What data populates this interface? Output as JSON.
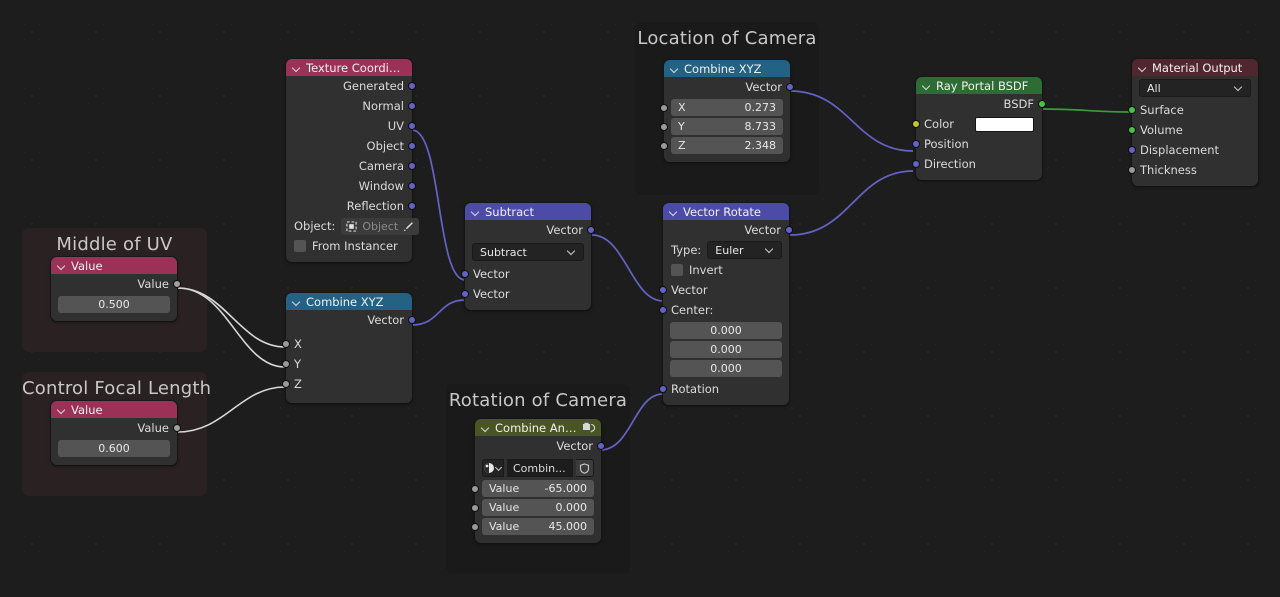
{
  "editor": {
    "name": "blender-shader-node-editor",
    "background": "#1d1d1d"
  },
  "colors": {
    "header_texture": "#9c3157",
    "header_value": "#9c3157",
    "header_output": "#50272f",
    "header_vector": "#4c4ca8",
    "header_converter": "#246283",
    "header_shader": "#2f6b34",
    "header_group": "#495622",
    "socket_vector": "#6363c7",
    "socket_shader": "#4ac24a",
    "socket_color": "#c7c729",
    "socket_float": "#9a9a9a",
    "link_gray": "#d8d8d8",
    "link_vector": "#6363c7",
    "link_shader": "#3c9c3c"
  },
  "frames": [
    {
      "label": "Middle of UV"
    },
    {
      "label": "Control Focal Length"
    },
    {
      "label": "Location of Camera"
    },
    {
      "label": "Rotation of Camera"
    }
  ],
  "nodes": {
    "texture_coordinate": {
      "title": "Texture Coordinate",
      "outputs": [
        "Generated",
        "Normal",
        "UV",
        "Object",
        "Camera",
        "Window",
        "Reflection"
      ],
      "object_label": "Object:",
      "object_value": "Object",
      "from_instancer_label": "From Instancer"
    },
    "value_uv": {
      "title": "Value",
      "output_label": "Value",
      "value": "0.500"
    },
    "value_focal": {
      "title": "Value",
      "output_label": "Value",
      "value": "0.600"
    },
    "combine_xyz_left": {
      "title": "Combine XYZ",
      "output_label": "Vector",
      "inputs": [
        "X",
        "Y",
        "Z"
      ]
    },
    "combine_xyz_location": {
      "title": "Combine XYZ",
      "output_label": "Vector",
      "fields": [
        {
          "name": "X",
          "value": "0.273"
        },
        {
          "name": "Y",
          "value": "8.733"
        },
        {
          "name": "Z",
          "value": "2.348"
        }
      ]
    },
    "subtract": {
      "title": "Subtract",
      "output_label": "Vector",
      "operation": "Subtract",
      "inputs": [
        "Vector",
        "Vector"
      ]
    },
    "vector_rotate": {
      "title": "Vector Rotate",
      "output_label": "Vector",
      "type_label": "Type:",
      "type_value": "Euler",
      "invert_label": "Invert",
      "vector_input": "Vector",
      "center_label": "Center:",
      "center_values": [
        "0.000",
        "0.000",
        "0.000"
      ],
      "rotation_input": "Rotation"
    },
    "combine_angles": {
      "title": "Combine Angles",
      "output_label": "Vector",
      "datablock_name": "Combin...",
      "fields": [
        {
          "name": "Value",
          "value": "-65.000"
        },
        {
          "name": "Value",
          "value": "0.000"
        },
        {
          "name": "Value",
          "value": "45.000"
        }
      ]
    },
    "ray_portal_bsdf": {
      "title": "Ray Portal BSDF",
      "output_label": "BSDF",
      "color_label": "Color",
      "color_value": "#ffffff",
      "position_label": "Position",
      "direction_label": "Direction"
    },
    "material_output": {
      "title": "Material Output",
      "target": "All",
      "inputs": [
        "Surface",
        "Volume",
        "Displacement",
        "Thickness"
      ]
    }
  },
  "links": [
    {
      "from": "texture_coordinate.UV",
      "to": "subtract.Vector1"
    },
    {
      "from": "combine_xyz_left.Vector",
      "to": "subtract.Vector2"
    },
    {
      "from": "value_uv.Value",
      "to": "combine_xyz_left.X"
    },
    {
      "from": "value_uv.Value",
      "to": "combine_xyz_left.Y"
    },
    {
      "from": "value_focal.Value",
      "to": "combine_xyz_left.Z"
    },
    {
      "from": "subtract.Vector",
      "to": "vector_rotate.Vector"
    },
    {
      "from": "combine_angles.Vector",
      "to": "vector_rotate.Rotation"
    },
    {
      "from": "combine_xyz_location.Vector",
      "to": "ray_portal_bsdf.Position"
    },
    {
      "from": "vector_rotate.Vector",
      "to": "ray_portal_bsdf.Direction"
    },
    {
      "from": "ray_portal_bsdf.BSDF",
      "to": "material_output.Surface"
    }
  ]
}
